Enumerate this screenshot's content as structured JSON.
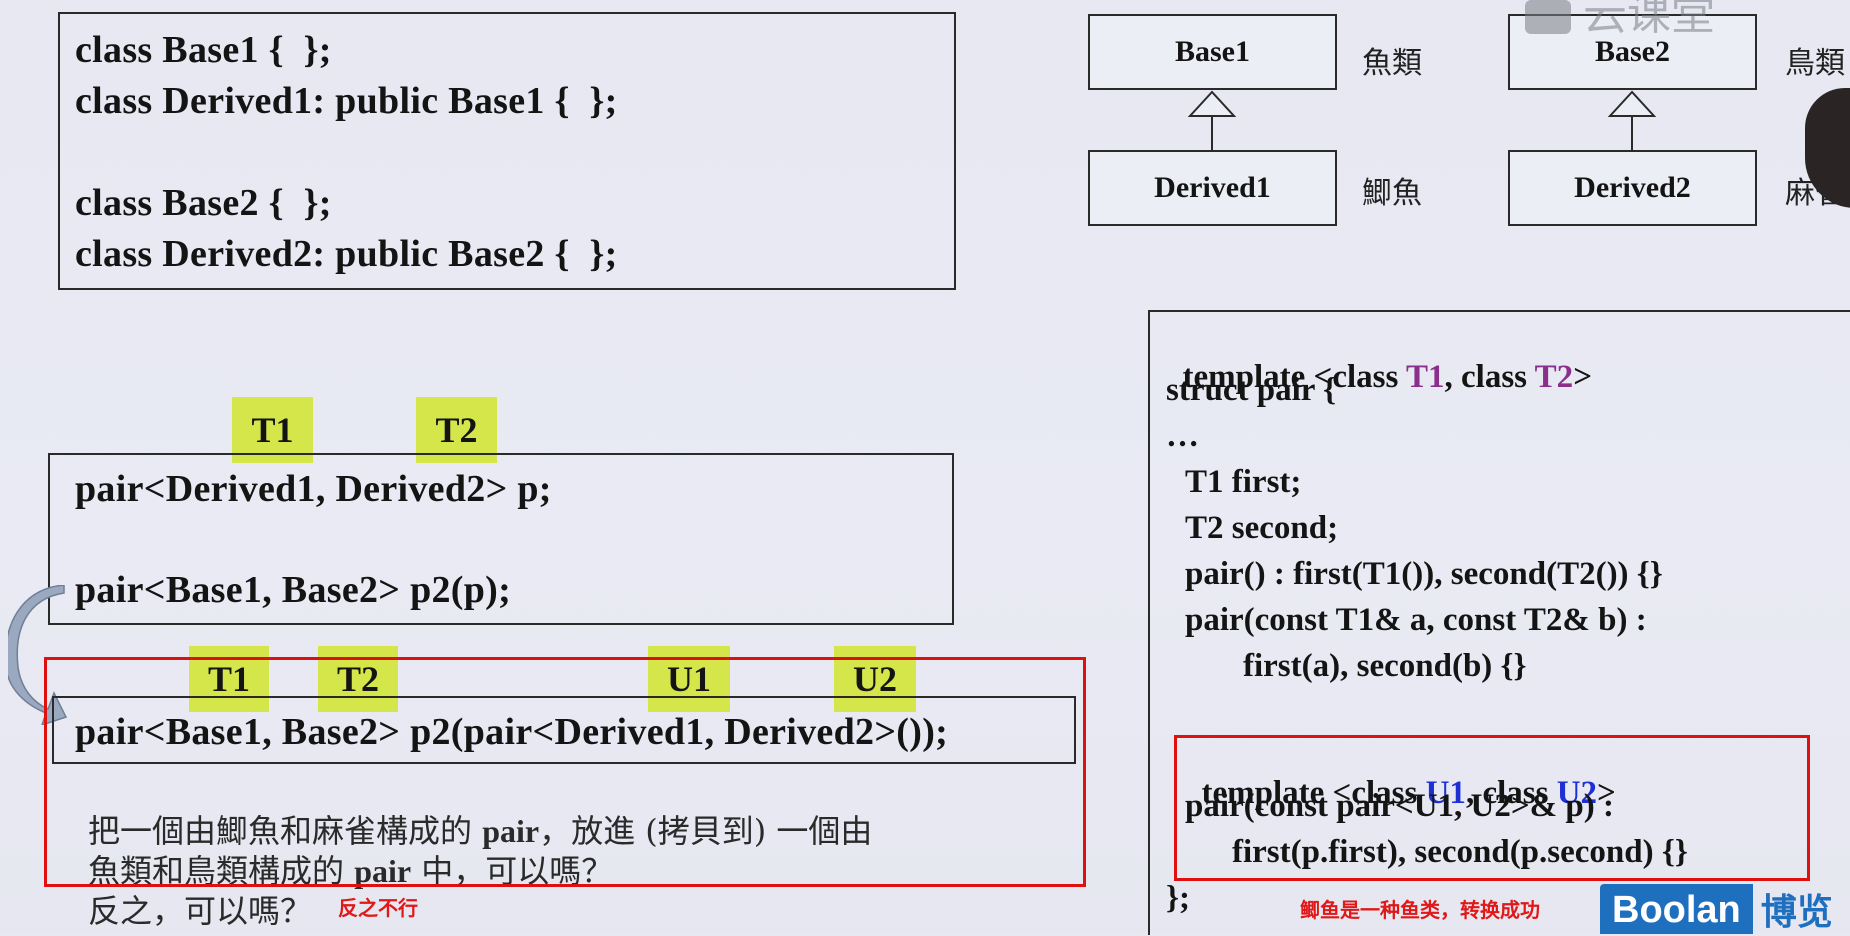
{
  "top_code": [
    "class Base1 {  };",
    "class Derived1: public Base1 {  };",
    "class Base2 {  };",
    "class Derived2: public Base2 {  };"
  ],
  "uml": {
    "base1": "Base1",
    "derived1": "Derived1",
    "base2": "Base2",
    "derived2": "Derived2",
    "label_base1": "魚類",
    "label_derived1": "鯽魚",
    "label_base2": "鳥類",
    "label_derived2": "麻雀"
  },
  "watermark_top": "云课堂",
  "tags": {
    "t1": "T1",
    "t2": "T2",
    "u1": "U1",
    "u2": "U2"
  },
  "mid_code": {
    "line1": "pair<Derived1, Derived2> p;",
    "line2": "pair<Base1, Base2> p2(p);"
  },
  "bottom_code": "pair<Base1, Base2> p2(pair<Derived1, Derived2>());",
  "question": {
    "line1_a": "把一個由鯽魚和麻雀構成的 ",
    "line1_b": "pair",
    "line1_c": "，放進 (拷貝到) 一個由",
    "line2_a": "魚類和鳥類構成的 ",
    "line2_b": "pair",
    "line2_c": " 中，可以嗎？",
    "line3": "反之，可以嗎？"
  },
  "notes": {
    "reverse": "反之不行",
    "success": "鲫鱼是一种鱼类，转换成功"
  },
  "right_code": {
    "l1_a": "template <class ",
    "l1_t1": "T1",
    "l1_b": ", class ",
    "l1_t2": "T2",
    "l1_c": ">",
    "l2": "struct pair {",
    "l3": "…",
    "l4": "T1 first;",
    "l5": "T2 second;",
    "l6": "pair() : first(T1()), second(T2()) {}",
    "l7": "pair(const T1& a, const T2& b) :",
    "l8": "first(a), second(b) {}",
    "l9_a": "template <class ",
    "l9_u1": "U1",
    "l9_b": ", class ",
    "l9_u2": "U2",
    "l9_c": ">",
    "l10": "pair(const pair<U1, U2>& p) :",
    "l11": "first(p.first), second(p.second) {}",
    "l12": "};"
  },
  "logo": {
    "text": "Boolan",
    "suffix": "博览"
  },
  "colors": {
    "highlight": "#d5e64a",
    "red": "#e01010",
    "purple": "#8a2f8c",
    "blue": "#1f2fd6",
    "logo_bg": "#1f6fbf"
  }
}
